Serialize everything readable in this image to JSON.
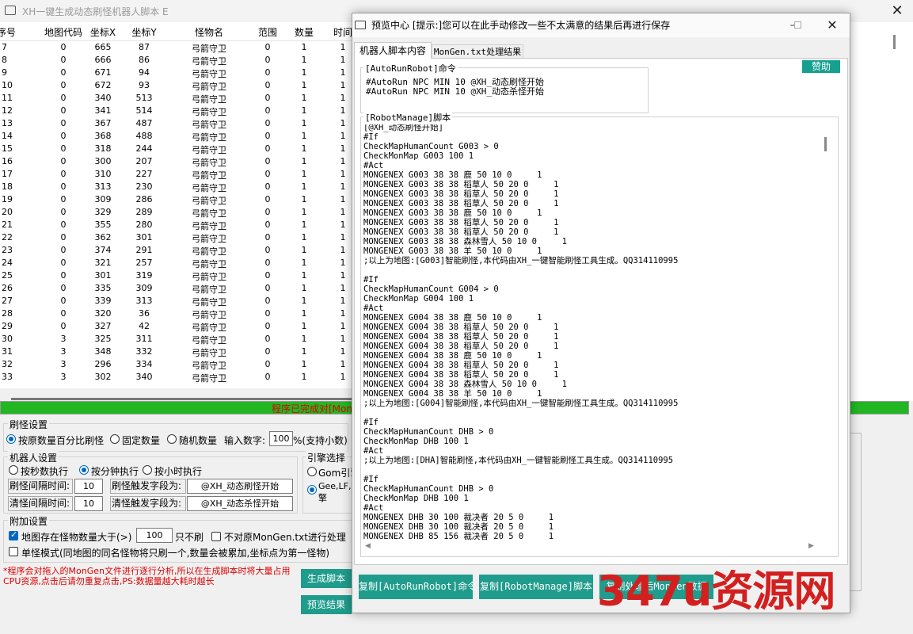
{
  "main": {
    "title": "XH一键生成动态刷怪机器人脚本 E",
    "columns": [
      "序号",
      "地图代码",
      "坐标X",
      "坐标Y",
      "怪物名",
      "范围",
      "数量",
      "时间"
    ],
    "rows": [
      [
        "7",
        "0",
        "665",
        "87",
        "弓箭守卫",
        "0",
        "1",
        "1"
      ],
      [
        "8",
        "0",
        "666",
        "86",
        "弓箭守卫",
        "0",
        "1",
        "1"
      ],
      [
        "9",
        "0",
        "671",
        "94",
        "弓箭守卫",
        "0",
        "1",
        "1"
      ],
      [
        "10",
        "0",
        "672",
        "93",
        "弓箭守卫",
        "0",
        "1",
        "1"
      ],
      [
        "11",
        "0",
        "340",
        "513",
        "弓箭守卫",
        "0",
        "1",
        "1"
      ],
      [
        "12",
        "0",
        "341",
        "514",
        "弓箭守卫",
        "0",
        "1",
        "1"
      ],
      [
        "13",
        "0",
        "367",
        "487",
        "弓箭守卫",
        "0",
        "1",
        "1"
      ],
      [
        "14",
        "0",
        "368",
        "488",
        "弓箭守卫",
        "0",
        "1",
        "1"
      ],
      [
        "15",
        "0",
        "318",
        "244",
        "弓箭守卫",
        "0",
        "1",
        "1"
      ],
      [
        "16",
        "0",
        "300",
        "207",
        "弓箭守卫",
        "0",
        "1",
        "1"
      ],
      [
        "17",
        "0",
        "310",
        "227",
        "弓箭守卫",
        "0",
        "1",
        "1"
      ],
      [
        "18",
        "0",
        "313",
        "230",
        "弓箭守卫",
        "0",
        "1",
        "1"
      ],
      [
        "19",
        "0",
        "309",
        "286",
        "弓箭守卫",
        "0",
        "1",
        "1"
      ],
      [
        "20",
        "0",
        "329",
        "289",
        "弓箭守卫",
        "0",
        "1",
        "1"
      ],
      [
        "21",
        "0",
        "355",
        "280",
        "弓箭守卫",
        "0",
        "1",
        "1"
      ],
      [
        "22",
        "0",
        "362",
        "301",
        "弓箭守卫",
        "0",
        "1",
        "1"
      ],
      [
        "23",
        "0",
        "374",
        "291",
        "弓箭守卫",
        "0",
        "1",
        "1"
      ],
      [
        "24",
        "0",
        "321",
        "257",
        "弓箭守卫",
        "0",
        "1",
        "1"
      ],
      [
        "25",
        "0",
        "301",
        "319",
        "弓箭守卫",
        "0",
        "1",
        "1"
      ],
      [
        "26",
        "0",
        "335",
        "309",
        "弓箭守卫",
        "0",
        "1",
        "1"
      ],
      [
        "27",
        "0",
        "339",
        "313",
        "弓箭守卫",
        "0",
        "1",
        "1"
      ],
      [
        "28",
        "0",
        "320",
        "36",
        "弓箭守卫",
        "0",
        "1",
        "1"
      ],
      [
        "29",
        "0",
        "327",
        "42",
        "弓箭守卫",
        "0",
        "1",
        "1"
      ],
      [
        "30",
        "3",
        "325",
        "311",
        "弓箭守卫",
        "0",
        "1",
        "1"
      ],
      [
        "31",
        "3",
        "348",
        "332",
        "弓箭守卫",
        "0",
        "1",
        "1"
      ],
      [
        "32",
        "3",
        "296",
        "334",
        "弓箭守卫",
        "0",
        "1",
        "1"
      ],
      [
        "33",
        "3",
        "302",
        "340",
        "弓箭守卫",
        "0",
        "1",
        "1"
      ]
    ],
    "progress_text": "程序已完成对[Mon",
    "refresh_settings": {
      "title": "刷怪设置",
      "opt_percent": "按原数量百分比刷怪",
      "opt_fixed": "固定数量",
      "opt_random": "随机数量",
      "input_label": "输入数字:",
      "input_value": "100",
      "input_suffix": "%(支持小数)"
    },
    "robot_settings": {
      "title": "机器人设置",
      "opt_sec": "按秒数执行",
      "opt_min": "按分钟执行",
      "opt_hour": "按小时执行",
      "refresh_interval_label": "刷怪间隔时间:",
      "refresh_interval_value": "10",
      "clear_interval_label": "清怪间隔时间:",
      "clear_interval_value": "10",
      "refresh_trigger_label": "刷怪触发字段为:",
      "refresh_trigger_value": "@XH_动态刷怪开始",
      "clear_trigger_label": "清怪触发字段为:",
      "clear_trigger_value": "@XH_动态杀怪开始"
    },
    "engine": {
      "title": "引擎选择",
      "opt_gom": "Gom引擎",
      "opt_gee_line1": "Gee,LF,",
      "opt_gee_line2": "擎"
    },
    "extra": {
      "title": "附加设置",
      "skip_label": "地图存在怪物数量大于(>)",
      "skip_value": "100",
      "skip_suffix": "只不刷",
      "no_process_label": "不对原MonGen.txt进行处理",
      "single_label": "单怪模式(同地图的同名怪物将只刷一个,数量会被累加,坐标点为第一怪物)"
    },
    "warning": "*程序会对拖入的MonGen文件进行逐行分析,所以在生成脚本时将大量占用CPU资源,点击后请勿重复点击,PS:数据量越大耗时越长",
    "btn_generate": "生成脚本",
    "btn_preview": "预览结果"
  },
  "dialog": {
    "title": "预览中心 [提示:]您可以在此手动修改一些不太满意的结果后再进行保存",
    "tab_script": "机器人脚本内容",
    "tab_mongen": "MonGen.txt处理结果",
    "donate": "赞助",
    "auto_label": "[AutoRunRobot]命令",
    "auto_text": "#AutoRun NPC MIN 10 @XH_动态刷怪开始\n#AutoRun NPC MIN 10 @XH_动态杀怪开始",
    "rm_label": "[RobotManage]脚本",
    "rm_text": "[@XH_动态刷怪开始]\n#If\nCheckMapHumanCount G003 > 0\nCheckMonMap G003 100 1\n#Act\nMONGENEX G003 38 38 鹿 50 10 0     1\nMONGENEX G003 38 38 稻草人 50 20 0     1\nMONGENEX G003 38 38 稻草人 50 20 0     1\nMONGENEX G003 38 38 稻草人 50 20 0     1\nMONGENEX G003 38 38 鹿 50 10 0     1\nMONGENEX G003 38 38 稻草人 50 20 0     1\nMONGENEX G003 38 38 稻草人 50 20 0     1\nMONGENEX G003 38 38 森林雪人 50 10 0     1\nMONGENEX G003 38 38 羊 50 10 0     1\n;以上为地图:[G003]智能刷怪,本代码由XH_一键智能刷怪工具生成。QQ314110995\n\n#If\nCheckMapHumanCount G004 > 0\nCheckMonMap G004 100 1\n#Act\nMONGENEX G004 38 38 鹿 50 10 0     1\nMONGENEX G004 38 38 稻草人 50 20 0     1\nMONGENEX G004 38 38 稻草人 50 20 0     1\nMONGENEX G004 38 38 稻草人 50 20 0     1\nMONGENEX G004 38 38 鹿 50 10 0     1\nMONGENEX G004 38 38 稻草人 50 20 0     1\nMONGENEX G004 38 38 稻草人 50 20 0     1\nMONGENEX G004 38 38 森林雪人 50 10 0     1\nMONGENEX G004 38 38 羊 50 10 0     1\n;以上为地图:[G004]智能刷怪,本代码由XH_一键智能刷怪工具生成。QQ314110995\n\n#If\nCheckMapHumanCount DHB > 0\nCheckMonMap DHB 100 1\n#Act\n;以上为地图:[DHA]智能刷怪,本代码由XH_一键智能刷怪工具生成。QQ314110995\n\n#If\nCheckMapHumanCount DHB > 0\nCheckMonMap DHB 100 1\n#Act\nMONGENEX DHB 30 100 裁决者 20 5 0     1\nMONGENEX DHB 30 100 裁决者 20 5 0     1\nMONGENEX DHB 85 156 裁决者 20 5 0     1",
    "btn_copy_auto": "复制[AutoRunRobot]命令",
    "btn_copy_rm": "复制[RobotManage]脚本",
    "btn_copy_mongen": "复制处理后MonGen数据"
  },
  "watermark": "347u资源网"
}
